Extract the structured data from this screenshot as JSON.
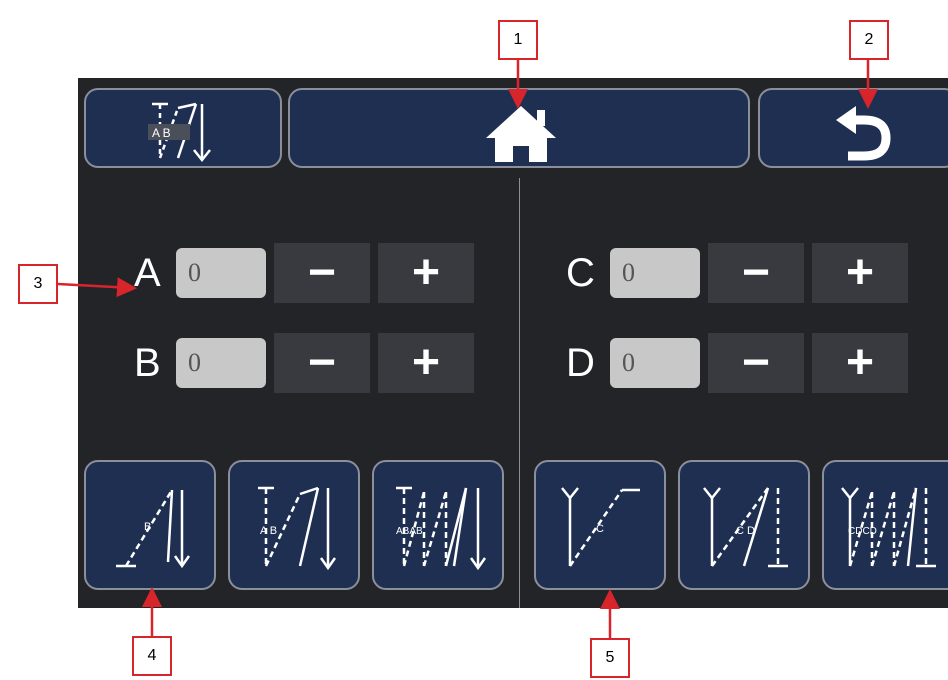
{
  "callouts": [
    "1",
    "2",
    "3",
    "4",
    "5"
  ],
  "header": {
    "stitch_mode_icon": "stitch-ab-icon",
    "home_icon": "home-icon",
    "back_icon": "back-undo-icon"
  },
  "params": {
    "a": {
      "label": "A",
      "value": "0"
    },
    "b": {
      "label": "B",
      "value": "0"
    },
    "c": {
      "label": "C",
      "value": "0"
    },
    "d": {
      "label": "D",
      "value": "0"
    },
    "minus": "−",
    "plus": "+"
  },
  "patterns": {
    "left": [
      {
        "name": "start-backtack-b",
        "icon_text": "B"
      },
      {
        "name": "start-backtack-ab",
        "icon_text": "A B"
      },
      {
        "name": "start-backtack-abab",
        "icon_text": "ABAB"
      }
    ],
    "right": [
      {
        "name": "end-backtack-c",
        "icon_text": "C"
      },
      {
        "name": "end-backtack-cd",
        "icon_text": "C D"
      },
      {
        "name": "end-backtack-cdcd",
        "icon_text": "CDCD"
      }
    ]
  },
  "colors": {
    "background": "#222428",
    "button_fill": "#1f2f52",
    "button_border": "#8a8f99",
    "field": "#c8c8c8",
    "stepper": "#383a3f",
    "callout_border": "#d8252b"
  }
}
